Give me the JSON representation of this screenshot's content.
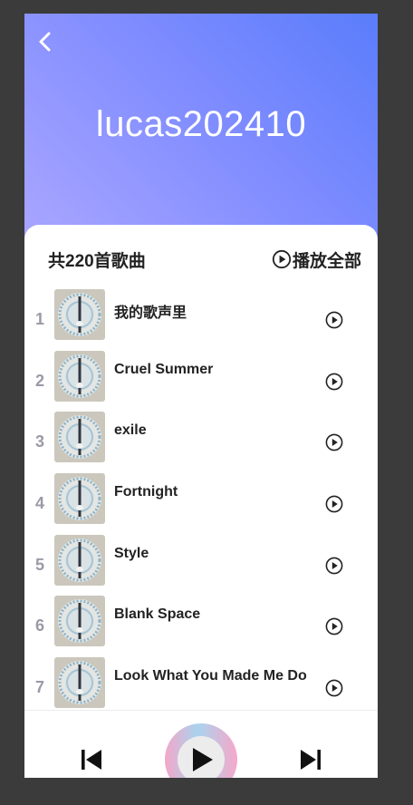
{
  "header": {
    "title": "lucas202410",
    "back_icon": "chevron-left-icon"
  },
  "list": {
    "count_label": "共220首歌曲",
    "play_all_label": "播放全部",
    "play_all_icon": "play-circle-icon",
    "songs": [
      {
        "index": "1",
        "title": "我的歌声里"
      },
      {
        "index": "2",
        "title": "Cruel Summer"
      },
      {
        "index": "3",
        "title": "exile"
      },
      {
        "index": "4",
        "title": "Fortnight"
      },
      {
        "index": "5",
        "title": "Style"
      },
      {
        "index": "6",
        "title": "Blank Space"
      },
      {
        "index": "7",
        "title": "Look What You Made Me Do"
      }
    ]
  },
  "player": {
    "prev_icon": "skip-previous-icon",
    "play_icon": "play-icon",
    "next_icon": "skip-next-icon"
  },
  "colors": {
    "hero_gradient": [
      "#5a7dfb",
      "#aaa6ff"
    ],
    "text_primary": "#222222",
    "index_text": "#9a9aa6"
  }
}
